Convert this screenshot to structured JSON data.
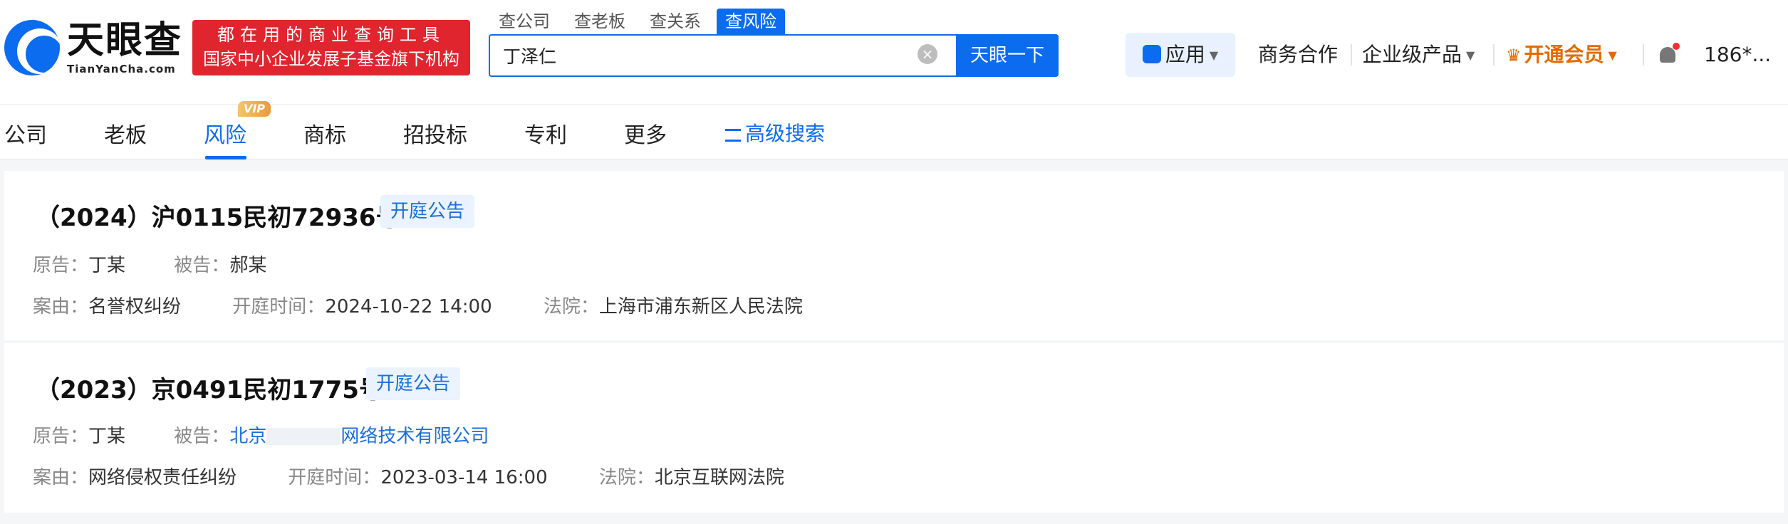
{
  "header": {
    "logo_cn": "天眼查",
    "logo_en": "TianYanCha.com",
    "slogan_line1": "都在用的商业查询工具",
    "slogan_line2": "国家中小企业发展子基金旗下机构"
  },
  "search": {
    "tabs": [
      "查公司",
      "查老板",
      "查关系",
      "查风险"
    ],
    "active_tab": "查风险",
    "query": "丁泽仁",
    "button": "天眼一下",
    "clear_glyph": "×"
  },
  "nav": {
    "app": "应用",
    "business": "商务合作",
    "enterprise": "企业级产品",
    "vip": "开通会员",
    "user": "186*..."
  },
  "subnav": {
    "items": [
      "公司",
      "老板",
      "风险",
      "商标",
      "招投标",
      "专利",
      "更多"
    ],
    "active": "风险",
    "vip_badge": "VIP",
    "advanced": "高级搜索"
  },
  "cases": [
    {
      "title": "（2024）沪0115民初72936号",
      "tag": "开庭公告",
      "plaintiff_label": "原告：",
      "plaintiff": "丁某",
      "defendant_label": "被告：",
      "defendant": "郝某",
      "cause_label": "案由：",
      "cause": "名誉权纠纷",
      "time_label": "开庭时间：",
      "time": "2024-10-22 14:00",
      "court_label": "法院：",
      "court": "上海市浦东新区人民法院"
    },
    {
      "title": "（2023）京0491民初1775号",
      "tag": "开庭公告",
      "plaintiff_label": "原告：",
      "plaintiff": "丁某",
      "defendant_label": "被告：",
      "defendant_prefix": "北京",
      "defendant_suffix": "网络技术有限公司",
      "cause_label": "案由：",
      "cause": "网络侵权责任纠纷",
      "time_label": "开庭时间：",
      "time": "2023-03-14 16:00",
      "court_label": "法院：",
      "court": "北京互联网法院"
    }
  ],
  "colors": {
    "brand_blue": "#0b6cf0",
    "slogan_red": "#e0252e",
    "vip_orange": "#e36a00",
    "tag_bg": "#eaf3ff"
  }
}
